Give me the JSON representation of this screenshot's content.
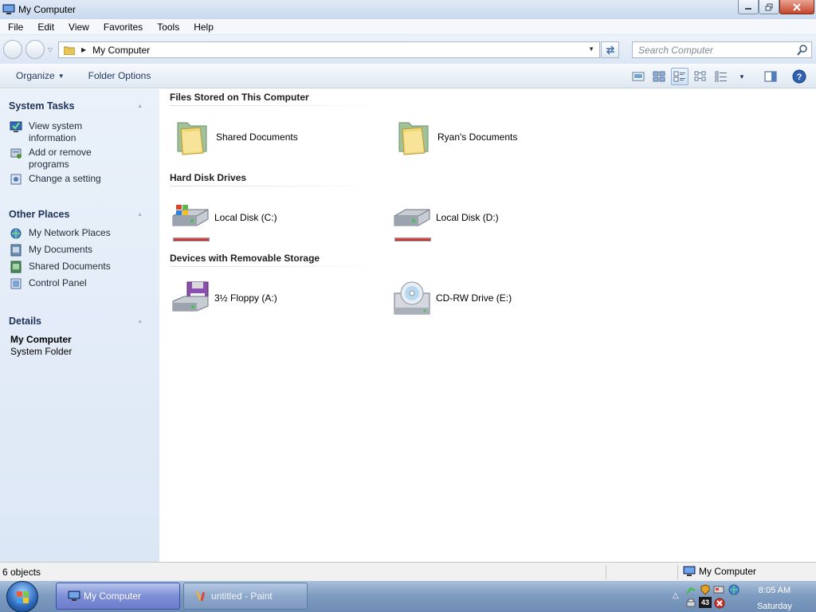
{
  "window": {
    "title": "My Computer"
  },
  "menu": [
    "File",
    "Edit",
    "View",
    "Favorites",
    "Tools",
    "Help"
  ],
  "address": {
    "path": "My Computer",
    "search_placeholder": "Search Computer"
  },
  "commands": {
    "organize": "Organize",
    "folder_options": "Folder Options"
  },
  "sidebar": {
    "system_tasks": {
      "title": "System Tasks",
      "items": [
        {
          "label": "View system information",
          "icon": "system-info-icon"
        },
        {
          "label": "Add or remove programs",
          "icon": "programs-icon"
        },
        {
          "label": "Change a setting",
          "icon": "settings-icon"
        }
      ]
    },
    "other_places": {
      "title": "Other Places",
      "items": [
        {
          "label": "My Network Places",
          "icon": "network-icon"
        },
        {
          "label": "My Documents",
          "icon": "documents-icon"
        },
        {
          "label": "Shared Documents",
          "icon": "shared-documents-icon"
        },
        {
          "label": "Control Panel",
          "icon": "control-panel-icon"
        }
      ]
    },
    "details": {
      "title": "Details",
      "name": "My Computer",
      "type": "System Folder"
    }
  },
  "groups": {
    "files": {
      "title": "Files Stored on This Computer",
      "items": [
        {
          "label": "Shared Documents",
          "icon": "folder-icon"
        },
        {
          "label": "Ryan's Documents",
          "icon": "folder-icon"
        }
      ]
    },
    "drives": {
      "title": "Hard Disk Drives",
      "items": [
        {
          "label": "Local Disk (C:)",
          "icon": "hard-disk-windows-icon"
        },
        {
          "label": "Local Disk (D:)",
          "icon": "hard-disk-icon"
        }
      ]
    },
    "removable": {
      "title": "Devices with Removable Storage",
      "items": [
        {
          "label": "3½ Floppy (A:)",
          "icon": "floppy-drive-icon"
        },
        {
          "label": "CD-RW Drive (E:)",
          "icon": "cd-drive-icon"
        }
      ]
    }
  },
  "status": {
    "count": "6 objects",
    "zone": "My Computer"
  },
  "taskbar": {
    "tasks": [
      {
        "label": "My Computer",
        "active": true
      },
      {
        "label": "untitled - Paint",
        "active": false
      }
    ],
    "tray_badge": "43",
    "time": "8:05 AM",
    "day": "Saturday"
  },
  "colors": {
    "accent": "#1e3257",
    "sidebar_bg": "#e3ecf7",
    "taskbar": "#7f9cc0",
    "capacity_bar": "#c62828"
  }
}
